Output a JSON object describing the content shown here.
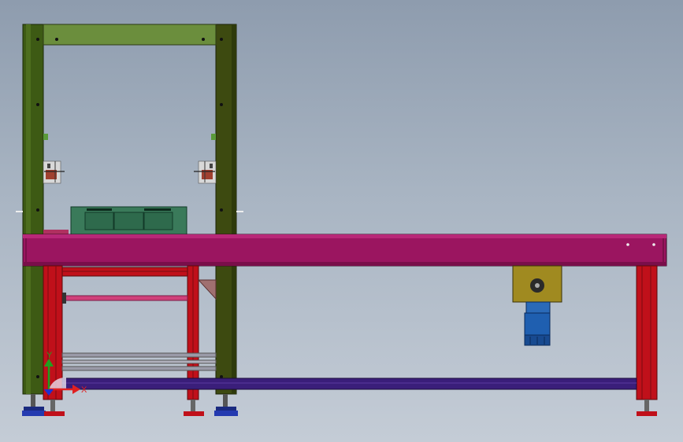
{
  "viewport": {
    "background_top": "#8e9cae",
    "background_bottom": "#c4ccd6"
  },
  "colors": {
    "frame_green": "#3d5a14",
    "frame_green_light": "#6b8e3d",
    "beam_magenta": "#9b1560",
    "leg_red": "#c0101a",
    "crate_green": "#3a7a5a",
    "gearbox_yellow": "#a08a20",
    "motor_blue": "#1f5fb0",
    "rail_purple": "#3a1e7a",
    "foot_blue": "#1a2a80"
  },
  "triad": {
    "x_label": "X",
    "y_label": "Y",
    "x_color": "#e02020",
    "y_color": "#20a020",
    "z_color": "#2030d0"
  }
}
